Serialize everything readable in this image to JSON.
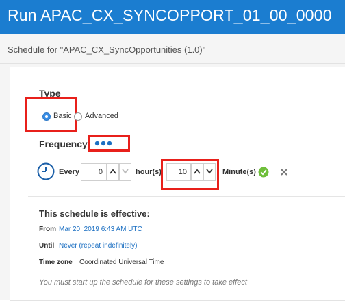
{
  "header": {
    "title": "Run APAC_CX_SYNCOPPORT_01_00_0000",
    "subtitle": "Schedule for \"APAC_CX_SyncOpportunities (1.0)\""
  },
  "type_section": {
    "label": "Type",
    "options": [
      {
        "label": "Basic",
        "selected": true
      },
      {
        "label": "Advanced",
        "selected": false
      }
    ]
  },
  "frequency": {
    "label": "Frequency",
    "more_icon": "ellipsis-icon",
    "every_label": "Every",
    "hours_value": "0",
    "hours_unit": "hour(s)",
    "minutes_value": "10",
    "minutes_unit": "Minute(s)",
    "clock_icon": "clock-icon",
    "confirm_icon": "check-icon",
    "cancel_icon": "close-icon"
  },
  "effective": {
    "heading": "This schedule is effective:",
    "from_label": "From",
    "from_value": "Mar 20, 2019 6:43 AM UTC",
    "until_label": "Until",
    "until_value": "Never (repeat indefinitely)",
    "timezone_label": "Time zone",
    "timezone_value": "Coordinated Universal Time",
    "note": "You must start up the schedule for these settings to take effect"
  },
  "colors": {
    "header_blue": "#1b7dd0",
    "highlight_red": "#e8201b",
    "link_blue": "#1b6fc2",
    "confirm_green": "#6fbf3b"
  }
}
